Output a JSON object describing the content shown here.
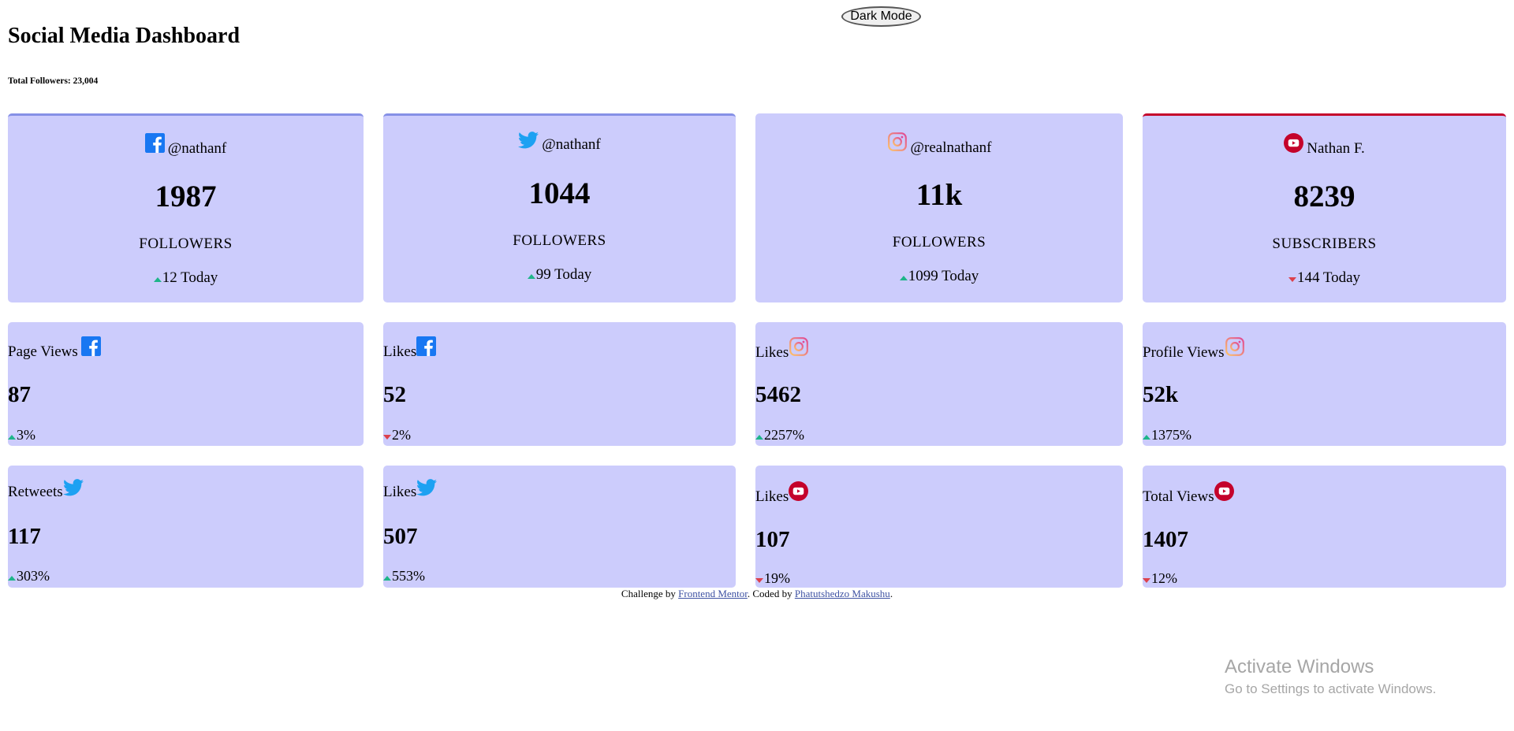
{
  "toggle": {
    "label": "Dark Mode"
  },
  "header": {
    "title": "Social Media Dashboard",
    "total": "Total Followers: 23,004"
  },
  "colors": {
    "card_bg": "#ccccfc",
    "up": "#1eb589",
    "down": "#dc414c",
    "facebook": "#1877f2",
    "twitter": "#1da1f2",
    "youtube": "#c4032b"
  },
  "followers": [
    {
      "platform": "facebook",
      "handle": "@nathanf",
      "count": "1987",
      "label": "FOLLOWERS",
      "today": "12 Today",
      "trend": "up"
    },
    {
      "platform": "twitter",
      "handle": "@nathanf",
      "count": "1044",
      "label": "FOLLOWERS",
      "today": "99 Today",
      "trend": "up"
    },
    {
      "platform": "instagram",
      "handle": "@realnathanf",
      "count": "11k",
      "label": "FOLLOWERS",
      "today": "1099 Today",
      "trend": "up"
    },
    {
      "platform": "youtube",
      "handle": "Nathan F.",
      "count": "8239",
      "label": "SUBSCRIBERS",
      "today": "144 Today",
      "trend": "down"
    }
  ],
  "overview": [
    {
      "title": "Page Views",
      "icon": "facebook-icon",
      "value": "87",
      "pct": "3%",
      "trend": "up"
    },
    {
      "title": "Likes",
      "icon": "facebook-icon",
      "value": "52",
      "pct": "2%",
      "trend": "down"
    },
    {
      "title": "Likes",
      "icon": "instagram-icon",
      "value": "5462",
      "pct": "2257%",
      "trend": "up"
    },
    {
      "title": "Profile Views",
      "icon": "instagram-icon",
      "value": "52k",
      "pct": "1375%",
      "trend": "up"
    },
    {
      "title": "Retweets",
      "icon": "twitter-icon",
      "value": "117",
      "pct": "303%",
      "trend": "up"
    },
    {
      "title": "Likes",
      "icon": "twitter-icon",
      "value": "507",
      "pct": "553%",
      "trend": "up"
    },
    {
      "title": "Likes",
      "icon": "youtube-icon",
      "value": "107",
      "pct": "19%",
      "trend": "down"
    },
    {
      "title": "Total Views",
      "icon": "youtube-icon",
      "value": "1407",
      "pct": "12%",
      "trend": "down"
    }
  ],
  "footer": {
    "prefix": "Challenge by ",
    "link1": "Frontend Mentor",
    "middle": ". Coded by ",
    "link2": "Phatutshedzo Makushu",
    "suffix": "."
  },
  "watermark": {
    "line1": "Activate Windows",
    "line2": "Go to Settings to activate Windows."
  }
}
